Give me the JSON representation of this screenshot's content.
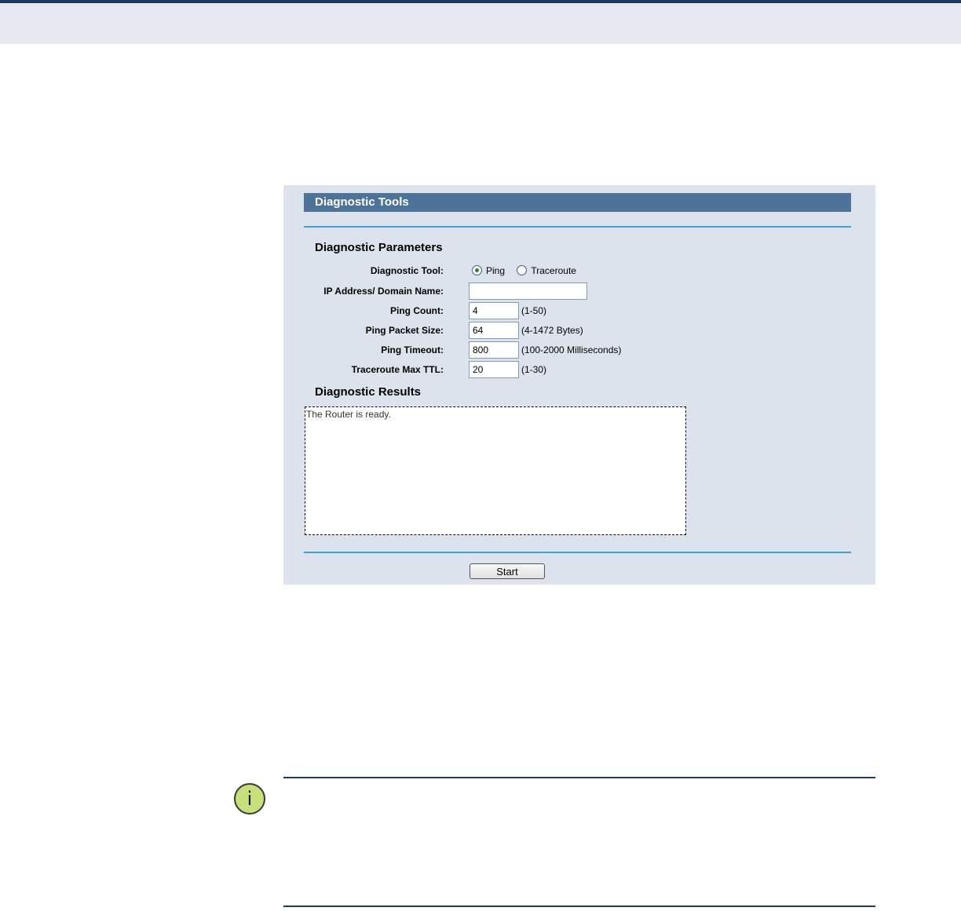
{
  "panel": {
    "title": "Diagnostic Tools",
    "parameters_title": "Diagnostic Parameters",
    "results_title": "Diagnostic Results"
  },
  "form": {
    "tool_label": "Diagnostic Tool:",
    "tool_options": [
      {
        "label": "Ping",
        "selected": true
      },
      {
        "label": "Traceroute",
        "selected": false
      }
    ],
    "ip_label": "IP Address/ Domain Name:",
    "ip_value": "",
    "ping_count_label": "Ping Count:",
    "ping_count_value": "4",
    "ping_count_hint": "(1-50)",
    "packet_size_label": "Ping Packet Size:",
    "packet_size_value": "64",
    "packet_size_hint": "(4-1472 Bytes)",
    "timeout_label": "Ping Timeout:",
    "timeout_value": "800",
    "timeout_hint": "(100-2000 Milliseconds)",
    "ttl_label": "Traceroute Max TTL:",
    "ttl_value": "20",
    "ttl_hint": "(1-30)"
  },
  "results": {
    "text": "The Router is ready."
  },
  "actions": {
    "start_label": "Start"
  },
  "note": {
    "icon": "info-icon",
    "icon_glyph": "i"
  }
}
